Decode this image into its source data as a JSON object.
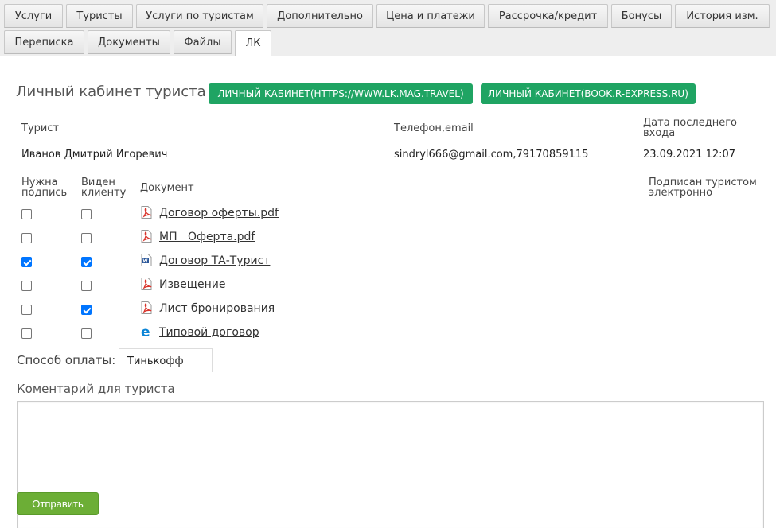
{
  "tabs": [
    {
      "label": "Услуги"
    },
    {
      "label": "Туристы"
    },
    {
      "label": "Услуги по туристам"
    },
    {
      "label": "Дополнительно"
    },
    {
      "label": "Цена и платежи"
    },
    {
      "label": "Рассрочка/кредит"
    },
    {
      "label": "Бонусы"
    },
    {
      "label": "История изм."
    },
    {
      "label": "Переписка"
    },
    {
      "label": "Документы"
    },
    {
      "label": "Файлы"
    },
    {
      "label": "ЛК",
      "active": true
    }
  ],
  "header": {
    "title": "Личный кабинет туриста",
    "link1": "ЛИЧНЫЙ КАБИНЕТ(HTTPS://WWW.LK.MAG.TRAVEL)",
    "link2": "ЛИЧНЫЙ КАБИНЕТ(BOOK.R-EXPRESS.RU)"
  },
  "info": {
    "tourist_header": "Турист",
    "contact_header": "Телефон,email",
    "last_login_header": "Дата последнего входа",
    "tourist_name": "Иванов Дмитрий Игоревич",
    "contact_value": "sindryl666@gmail.com,79170859115",
    "last_login_value": "23.09.2021 12:07"
  },
  "documents": {
    "col_sign": "Нужна подпись",
    "col_visible": "Виден клиенту",
    "col_doc": "Документ",
    "col_signed": "Подписан туристом электронно",
    "rows": [
      {
        "name": "Договор оферты.pdf",
        "icon": "pdf-icon",
        "sign": false,
        "visible": false
      },
      {
        "name": "МП   Оферта.pdf",
        "icon": "pdf-icon",
        "sign": false,
        "visible": false
      },
      {
        "name": "Договор ТА-Турист",
        "icon": "word-icon",
        "sign": true,
        "visible": true
      },
      {
        "name": "Извещение",
        "icon": "pdf-icon",
        "sign": false,
        "visible": false
      },
      {
        "name": "Лист бронирования",
        "icon": "pdf-icon",
        "sign": false,
        "visible": true
      },
      {
        "name": "Типовой договор",
        "icon": "edge-icon",
        "sign": false,
        "visible": false
      }
    ]
  },
  "payment": {
    "label": "Способ оплаты:",
    "value": "Тинькофф"
  },
  "comment": {
    "label": "Коментарий для туриста",
    "value": ""
  },
  "send_label": "Отправить",
  "colors": {
    "link_button": "#1fa463",
    "send_button": "#6cae36",
    "checkbox_checked": "#0075ff",
    "pdf_icon": "#d9342b",
    "word_icon": "#2b579a",
    "edge_icon": "#0a84d6"
  }
}
